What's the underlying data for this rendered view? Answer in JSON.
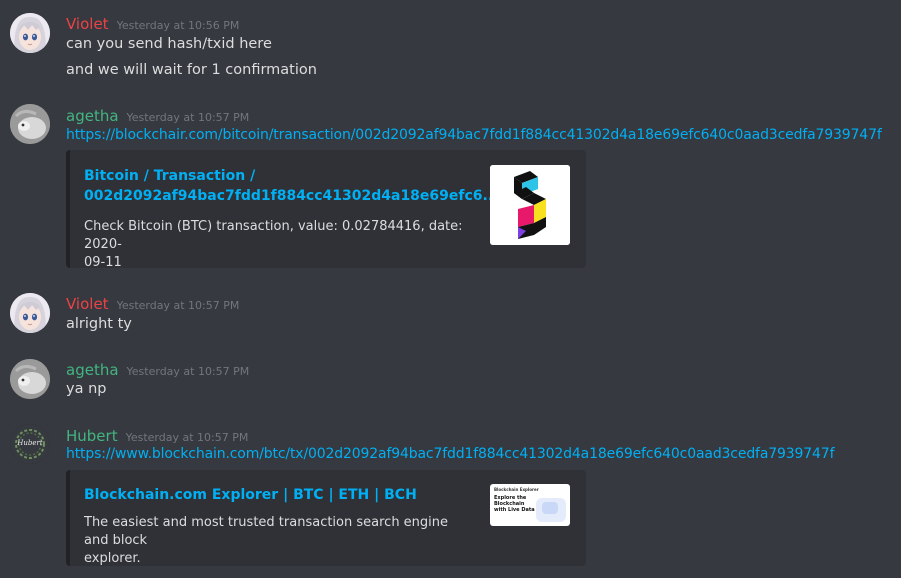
{
  "messages": [
    {
      "author": "Violet",
      "author_color": "#ed4245",
      "timestamp": "Yesterday at 10:56 PM",
      "lines": [
        "can you send hash/txid here",
        "and we will wait for 1 confirmation"
      ]
    },
    {
      "author": "agetha",
      "author_color": "#43b581",
      "timestamp": "Yesterday at 10:57 PM",
      "link": "https://blockchair.com/bitcoin/transaction/002d2092af94bac7fdd1f884cc41302d4a18e69efc640c0aad3cedfa7939747f",
      "embed": {
        "title_line1": "Bitcoin / Transaction /",
        "title_line2": "002d2092af94bac7fdd1f884cc41302d4a18e69efc6...",
        "desc_line1": "Check Bitcoin (BTC) transaction, value: 0.02784416, date: 2020-",
        "desc_line2": "09-11",
        "thumbnail_icon": "blockchair-logo"
      }
    },
    {
      "author": "Violet",
      "author_color": "#ed4245",
      "timestamp": "Yesterday at 10:57 PM",
      "lines": [
        "alright ty"
      ]
    },
    {
      "author": "agetha",
      "author_color": "#43b581",
      "timestamp": "Yesterday at 10:57 PM",
      "lines": [
        "ya np"
      ]
    },
    {
      "author": "Hubert",
      "author_color": "#43b581",
      "timestamp": "Yesterday at 10:57 PM",
      "avatar_text": "Hubert",
      "link": "https://www.blockchain.com/btc/tx/002d2092af94bac7fdd1f884cc41302d4a18e69efc640c0aad3cedfa7939747f",
      "embed": {
        "title_line1": "Blockchain.com Explorer | BTC | ETH | BCH",
        "desc_line1": "The easiest and most trusted transaction search engine and block",
        "desc_line2": "explorer.",
        "thumb_brand": "Blockchain Explorer",
        "thumb_heading": [
          "Explore the",
          "Blockchain",
          "with Live Data"
        ]
      }
    }
  ]
}
